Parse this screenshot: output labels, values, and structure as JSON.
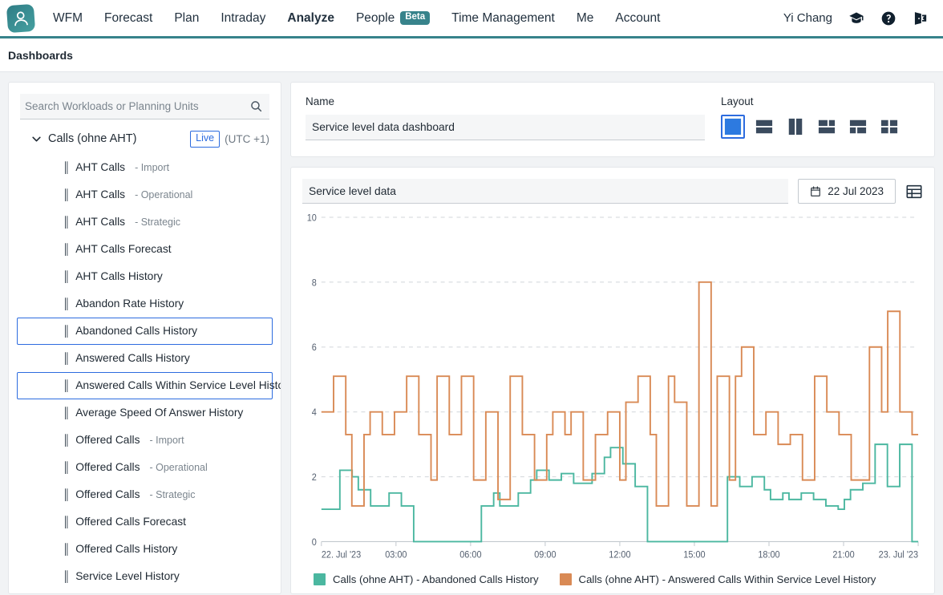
{
  "brand": {
    "accent_teal": "#37838b",
    "accent_blue": "#2d6cdf",
    "logo_icon": "person-avatar-icon"
  },
  "navbar": {
    "items": [
      {
        "label": "WFM",
        "active": false
      },
      {
        "label": "Forecast",
        "active": false
      },
      {
        "label": "Plan",
        "active": false
      },
      {
        "label": "Intraday",
        "active": false
      },
      {
        "label": "Analyze",
        "active": true
      },
      {
        "label": "People",
        "active": false,
        "badge": "Beta"
      },
      {
        "label": "Time Management",
        "active": false
      },
      {
        "label": "Me",
        "active": false
      },
      {
        "label": "Account",
        "active": false
      }
    ],
    "user": "Yi Chang",
    "icons": [
      "graduation-cap-icon",
      "help-circle-icon",
      "sign-out-icon"
    ]
  },
  "breadcrumb": {
    "label": "Dashboards"
  },
  "sidebar": {
    "search": {
      "placeholder": "Search Workloads or Planning Units",
      "value": "",
      "icon": "search-icon"
    },
    "group": {
      "name": "Calls (ohne AHT)",
      "live_badge": "Live",
      "timezone": "(UTC +1)",
      "expanded": true
    },
    "items": [
      {
        "label": "AHT Calls",
        "sub": "- Import",
        "selected": false
      },
      {
        "label": "AHT Calls",
        "sub": "- Operational",
        "selected": false
      },
      {
        "label": "AHT Calls",
        "sub": "- Strategic",
        "selected": false
      },
      {
        "label": "AHT Calls Forecast",
        "sub": "",
        "selected": false
      },
      {
        "label": "AHT Calls History",
        "sub": "",
        "selected": false
      },
      {
        "label": "Abandon Rate History",
        "sub": "",
        "selected": false
      },
      {
        "label": "Abandoned Calls History",
        "sub": "",
        "selected": true
      },
      {
        "label": "Answered Calls History",
        "sub": "",
        "selected": false
      },
      {
        "label": "Answered Calls Within Service Level Histo",
        "sub": "",
        "selected": true
      },
      {
        "label": "Average Speed Of Answer History",
        "sub": "",
        "selected": false
      },
      {
        "label": "Offered Calls",
        "sub": "- Import",
        "selected": false
      },
      {
        "label": "Offered Calls",
        "sub": "- Operational",
        "selected": false
      },
      {
        "label": "Offered Calls",
        "sub": "- Strategic",
        "selected": false
      },
      {
        "label": "Offered Calls Forecast",
        "sub": "",
        "selected": false
      },
      {
        "label": "Offered Calls History",
        "sub": "",
        "selected": false
      },
      {
        "label": "Service Level History",
        "sub": "",
        "selected": false
      }
    ]
  },
  "dashboard": {
    "name_label": "Name",
    "name_value": "Service level data dashboard",
    "layout_label": "Layout",
    "layout_options": [
      {
        "name": "layout-single",
        "selected": true
      },
      {
        "name": "layout-two-rows",
        "selected": false
      },
      {
        "name": "layout-two-columns",
        "selected": false
      },
      {
        "name": "layout-two-top-one-bottom",
        "selected": false
      },
      {
        "name": "layout-one-top-two-bottom",
        "selected": false
      },
      {
        "name": "layout-quad",
        "selected": false
      }
    ]
  },
  "widget": {
    "title": "Service level data",
    "date": "22 Jul 2023",
    "calendar_icon": "calendar-icon",
    "table_view_icon": "table-grid-icon"
  },
  "chart_data": {
    "type": "line",
    "line_style": "step",
    "title": "Service level data",
    "xlabel": "",
    "ylabel": "",
    "ylim": [
      0,
      10
    ],
    "yticks": [
      0,
      2,
      4,
      6,
      8,
      10
    ],
    "grid": true,
    "legend_position": "bottom-left",
    "x_tick_labels": [
      "22. Jul '23",
      "03:00",
      "06:00",
      "09:00",
      "12:00",
      "15:00",
      "18:00",
      "21:00",
      "23. Jul '23"
    ],
    "x_interval_minutes": 15,
    "x_points": 96,
    "colors": {
      "abandoned": "#4bb7a0",
      "answered_within_sl": "#d98a55"
    },
    "series": [
      {
        "name": "Calls (ohne AHT) - Abandoned Calls History",
        "color": "#4bb7a0",
        "values": [
          1,
          1,
          1,
          2.2,
          2.2,
          2,
          1.6,
          1.6,
          1.1,
          1.1,
          1.1,
          1.5,
          1.5,
          1.1,
          1.1,
          0,
          0,
          0,
          0,
          0,
          0,
          0,
          0,
          0,
          0,
          0,
          1.1,
          1.1,
          1.5,
          1.1,
          1.1,
          1.1,
          1.5,
          1.5,
          1.9,
          2.2,
          2.2,
          1.9,
          1.9,
          2.1,
          2.1,
          1.8,
          1.8,
          1.8,
          2.1,
          2.1,
          2.6,
          2.9,
          2.9,
          2.4,
          2.4,
          1.7,
          1.7,
          0,
          0,
          0,
          0,
          0,
          0,
          0,
          0,
          0,
          0,
          0,
          0,
          0,
          2,
          2,
          1.7,
          1.7,
          2,
          2,
          1.6,
          1.3,
          1.3,
          1.5,
          1.3,
          1.3,
          1.5,
          1.5,
          1.3,
          1.3,
          1.1,
          1.1,
          1,
          1.3,
          1.6,
          1.6,
          1.8,
          1.8,
          3,
          3,
          1.7,
          1.7,
          3,
          3,
          0
        ]
      },
      {
        "name": "Calls (ohne AHT) - Answered Calls Within Service Level History",
        "color": "#d98a55",
        "values": [
          4,
          4,
          5.1,
          5.1,
          3.3,
          1.1,
          1.1,
          3.3,
          4,
          4,
          3.3,
          3.3,
          4,
          4,
          5.1,
          5.1,
          3.3,
          3.3,
          1.9,
          5.1,
          5.1,
          3.3,
          3.3,
          5.1,
          5.1,
          1.9,
          1.9,
          4,
          4,
          1.3,
          1.3,
          5.1,
          5.1,
          3.3,
          3.3,
          1.9,
          1.9,
          3.3,
          4,
          4,
          3.3,
          4,
          4,
          1.9,
          1.9,
          3.3,
          3.3,
          4,
          4,
          1.9,
          4.3,
          4.3,
          5.1,
          5.1,
          3.3,
          1.1,
          1.1,
          5.1,
          4.3,
          4.3,
          1.1,
          1.1,
          8,
          8,
          1.1,
          5.1,
          5.1,
          1.9,
          5.1,
          6,
          6,
          3.3,
          3.3,
          4,
          4,
          3,
          3,
          3.3,
          3.3,
          1.9,
          1.9,
          5.1,
          5.1,
          4,
          4,
          3.3,
          3.3,
          1.9,
          1.9,
          1.9,
          6,
          6,
          4,
          7.1,
          7.1,
          4,
          4,
          3.3
        ]
      }
    ]
  }
}
